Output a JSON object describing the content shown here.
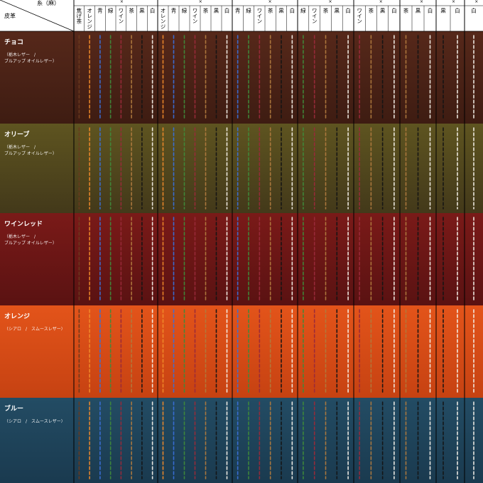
{
  "header": {
    "corner_top": "糸（麻）",
    "corner_bottom": "皮革",
    "mark": "×"
  },
  "groups": [
    {
      "base": "#5a1d12",
      "columns": [
        "焦げ茶",
        "オレンジ",
        "青",
        "緑",
        "ワイン",
        "茶",
        "黒",
        "白"
      ]
    },
    {
      "base": "#a85020",
      "columns": [
        "オレンジ",
        "青",
        "緑",
        "ワイン",
        "茶",
        "黒",
        "白"
      ]
    },
    {
      "base": "#8a1f1c",
      "columns": [
        "青",
        "緑",
        "ワイン",
        "茶",
        "黒",
        "白"
      ]
    },
    {
      "base": "#1f3d5c",
      "columns": [
        "緑",
        "ワイン",
        "茶",
        "黒",
        "白"
      ]
    },
    {
      "base": "#4a2a1a",
      "columns": [
        "ワイン",
        "茶",
        "黒",
        "白"
      ]
    },
    {
      "base": "#3a2a1c",
      "columns": [
        "茶",
        "黒",
        "白"
      ]
    },
    {
      "base": "#222",
      "columns": [
        "黒",
        "白"
      ]
    },
    {
      "base": "#ddd",
      "columns": [
        "白"
      ]
    }
  ],
  "leathers": [
    {
      "name": "チョコ",
      "sub1": "（栃木レザー　/",
      "sub2": "ブルアップ オイルレザー）",
      "color_top": "#56281a",
      "color_bottom": "#3e1c12"
    },
    {
      "name": "オリーブ",
      "sub1": "（栃木レザー　/",
      "sub2": "ブルアップ オイルレザー）",
      "color_top": "#5e5420",
      "color_bottom": "#43391a"
    },
    {
      "name": "ワインレッド",
      "sub1": "（栃木レザー　/",
      "sub2": "ブルアップ オイルレザー）",
      "color_top": "#7a1a18",
      "color_bottom": "#5a1212"
    },
    {
      "name": "オレンジ",
      "sub1": "（シアロ　/　スムースレザー）",
      "sub2": "",
      "color_top": "#e3541a",
      "color_bottom": "#c64212"
    },
    {
      "name": "ブルー",
      "sub1": "（シアロ　/　スムースレザー）",
      "sub2": "",
      "color_top": "#234c64",
      "color_bottom": "#1a3a4f"
    }
  ],
  "thread_colors": {
    "焦げ茶": "#6b3a1e",
    "オレンジ": "#f08a2a",
    "青": "#3a6fd8",
    "緑": "#3f8a3a",
    "ワイン": "#9a2a3a",
    "茶": "#b07a3e",
    "黒": "#141414",
    "白": "#f4f0e8"
  }
}
